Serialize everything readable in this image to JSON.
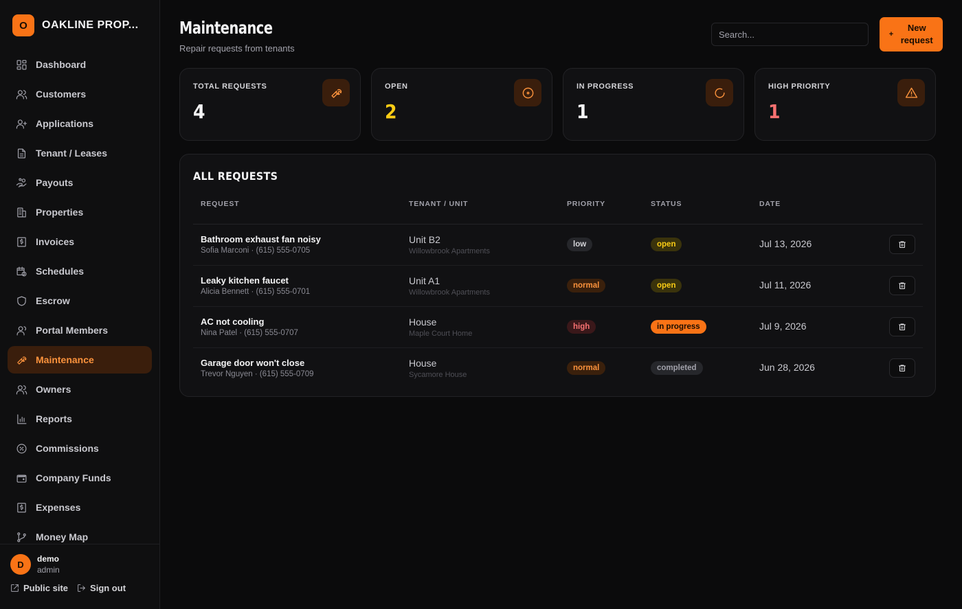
{
  "brand": {
    "initial": "O",
    "name": "OAKLINE PROP..."
  },
  "sidebar": {
    "items": [
      {
        "label": "Dashboard",
        "icon": "dashboard-icon"
      },
      {
        "label": "Customers",
        "icon": "users-icon"
      },
      {
        "label": "Applications",
        "icon": "user-plus-icon"
      },
      {
        "label": "Tenant / Leases",
        "icon": "document-icon"
      },
      {
        "label": "Payouts",
        "icon": "hand-coins-icon"
      },
      {
        "label": "Properties",
        "icon": "building-icon"
      },
      {
        "label": "Invoices",
        "icon": "receipt-icon"
      },
      {
        "label": "Schedules",
        "icon": "calendar-clock-icon"
      },
      {
        "label": "Escrow",
        "icon": "shield-icon"
      },
      {
        "label": "Portal Members",
        "icon": "user-group-icon"
      },
      {
        "label": "Maintenance",
        "icon": "wrench-icon",
        "active": true
      },
      {
        "label": "Owners",
        "icon": "users-icon"
      },
      {
        "label": "Reports",
        "icon": "bar-chart-icon"
      },
      {
        "label": "Commissions",
        "icon": "percent-icon"
      },
      {
        "label": "Company Funds",
        "icon": "wallet-icon"
      },
      {
        "label": "Expenses",
        "icon": "receipt-icon"
      },
      {
        "label": "Money Map",
        "icon": "git-branch-icon"
      }
    ]
  },
  "user": {
    "initial": "D",
    "name": "demo",
    "role": "admin"
  },
  "footer": {
    "public_site": "Public site",
    "sign_out": "Sign out"
  },
  "header": {
    "title": "Maintenance",
    "subtitle": "Repair requests from tenants",
    "search_placeholder": "Search...",
    "new_button": "New request",
    "new_button_icon": "+"
  },
  "stats": [
    {
      "label": "TOTAL REQUESTS",
      "value": "4",
      "color": "#f4f4f5",
      "icon": "wrench-icon"
    },
    {
      "label": "OPEN",
      "value": "2",
      "color": "#facc15",
      "icon": "circle-dot-icon"
    },
    {
      "label": "IN PROGRESS",
      "value": "1",
      "color": "#f4f4f5",
      "icon": "loader-icon"
    },
    {
      "label": "HIGH PRIORITY",
      "value": "1",
      "color": "#f87171",
      "icon": "alert-triangle-icon"
    }
  ],
  "table": {
    "title": "ALL REQUESTS",
    "columns": [
      "REQUEST",
      "TENANT / UNIT",
      "PRIORITY",
      "STATUS",
      "DATE"
    ],
    "rows": [
      {
        "title": "Bathroom exhaust fan noisy",
        "contact": "Sofia Marconi · (615) 555-0705",
        "unit": "Unit B2",
        "property": "Willowbrook Apartments",
        "priority": "low",
        "status": "open",
        "date": "Jul 13, 2026"
      },
      {
        "title": "Leaky kitchen faucet",
        "contact": "Alicia Bennett · (615) 555-0701",
        "unit": "Unit A1",
        "property": "Willowbrook Apartments",
        "priority": "normal",
        "status": "open",
        "date": "Jul 11, 2026"
      },
      {
        "title": "AC not cooling",
        "contact": "Nina Patel · (615) 555-0707",
        "unit": "House",
        "property": "Maple Court Home",
        "priority": "high",
        "status": "in progress",
        "date": "Jul 9, 2026"
      },
      {
        "title": "Garage door won't close",
        "contact": "Trevor Nguyen · (615) 555-0709",
        "unit": "House",
        "property": "Sycamore House",
        "priority": "normal",
        "status": "completed",
        "date": "Jun 28, 2026"
      }
    ]
  }
}
